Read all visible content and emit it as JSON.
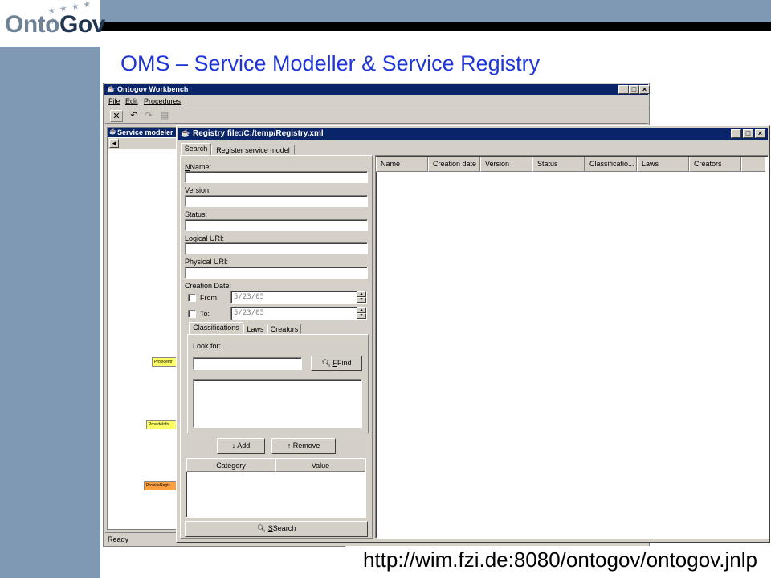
{
  "slide": {
    "logo_text_onto": "Onto",
    "logo_text_gov": "Gov",
    "title": "OMS – Service Modeller & Service Registry",
    "url": "http://wim.fzi.de:8080/ontogov/ontogov.jnlp"
  },
  "workbench": {
    "title": "Ontogov Workbench",
    "menu": [
      "File",
      "Edit",
      "Procedures"
    ],
    "panel_title": "Service modeler",
    "status": "Ready",
    "nodes": [
      "ProvideInf",
      "ProvideInfo",
      "ProvideRegis"
    ]
  },
  "registry": {
    "title": "Registry file:/C:/temp/Registry.xml",
    "tabs": [
      "Search",
      "Register service model"
    ],
    "fields": {
      "name": "Name:",
      "version": "Version:",
      "status": "Status:",
      "logical_uri": "Logical URI:",
      "physical_uri": "Physical URI:",
      "creation_date": "Creation Date:",
      "from": "From:",
      "to": "To:",
      "from_value": "5/23/05",
      "to_value": "5/23/05"
    },
    "subtabs": [
      "Classifications",
      "Laws",
      "Creators"
    ],
    "look_for": "Look for:",
    "find": "Find",
    "add": "Add",
    "remove": "Remove",
    "category_cols": [
      "Category",
      "Value"
    ],
    "search_button": "Search",
    "result_columns": [
      "Name",
      "Creation date",
      "Version",
      "Status",
      "Classificatio...",
      "Laws",
      "Creators"
    ]
  },
  "colors": {
    "accent_title": "#1f35d6",
    "band": "#7f99b5",
    "titlebar": "#0a246a",
    "node_yellow": "#ffff66",
    "node_orange": "#ffa040"
  }
}
